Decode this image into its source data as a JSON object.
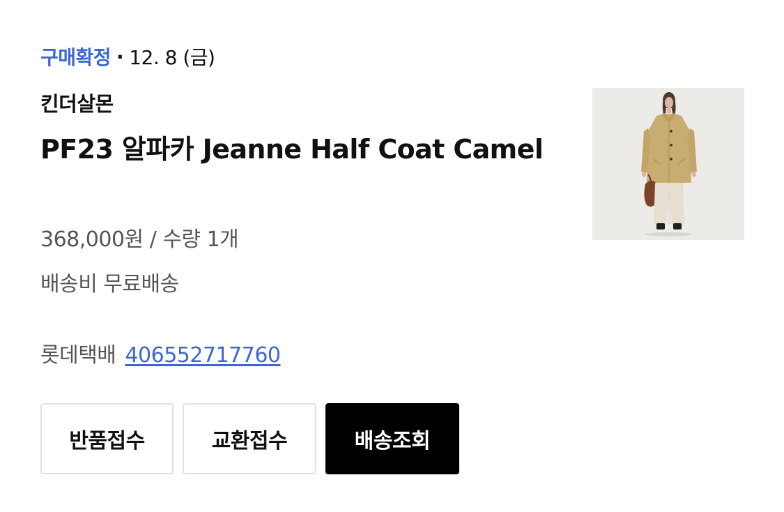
{
  "order": {
    "status": "구매확정",
    "separator": "·",
    "date": "12. 8 (금)",
    "brand": "킨더살몬",
    "product_name": "PF23 알파카 Jeanne Half Coat Camel",
    "price_quantity": "368,000원 / 수량 1개",
    "shipping": "배송비 무료배송",
    "courier": "롯데택배",
    "tracking_number": "406552717760"
  },
  "buttons": {
    "return_label": "반품접수",
    "exchange_label": "교환접수",
    "track_label": "배송조회"
  },
  "colors": {
    "status_accent": "#3a66d6",
    "link": "#3a66d6",
    "primary_button_bg": "#000000",
    "muted_text": "#555555"
  }
}
